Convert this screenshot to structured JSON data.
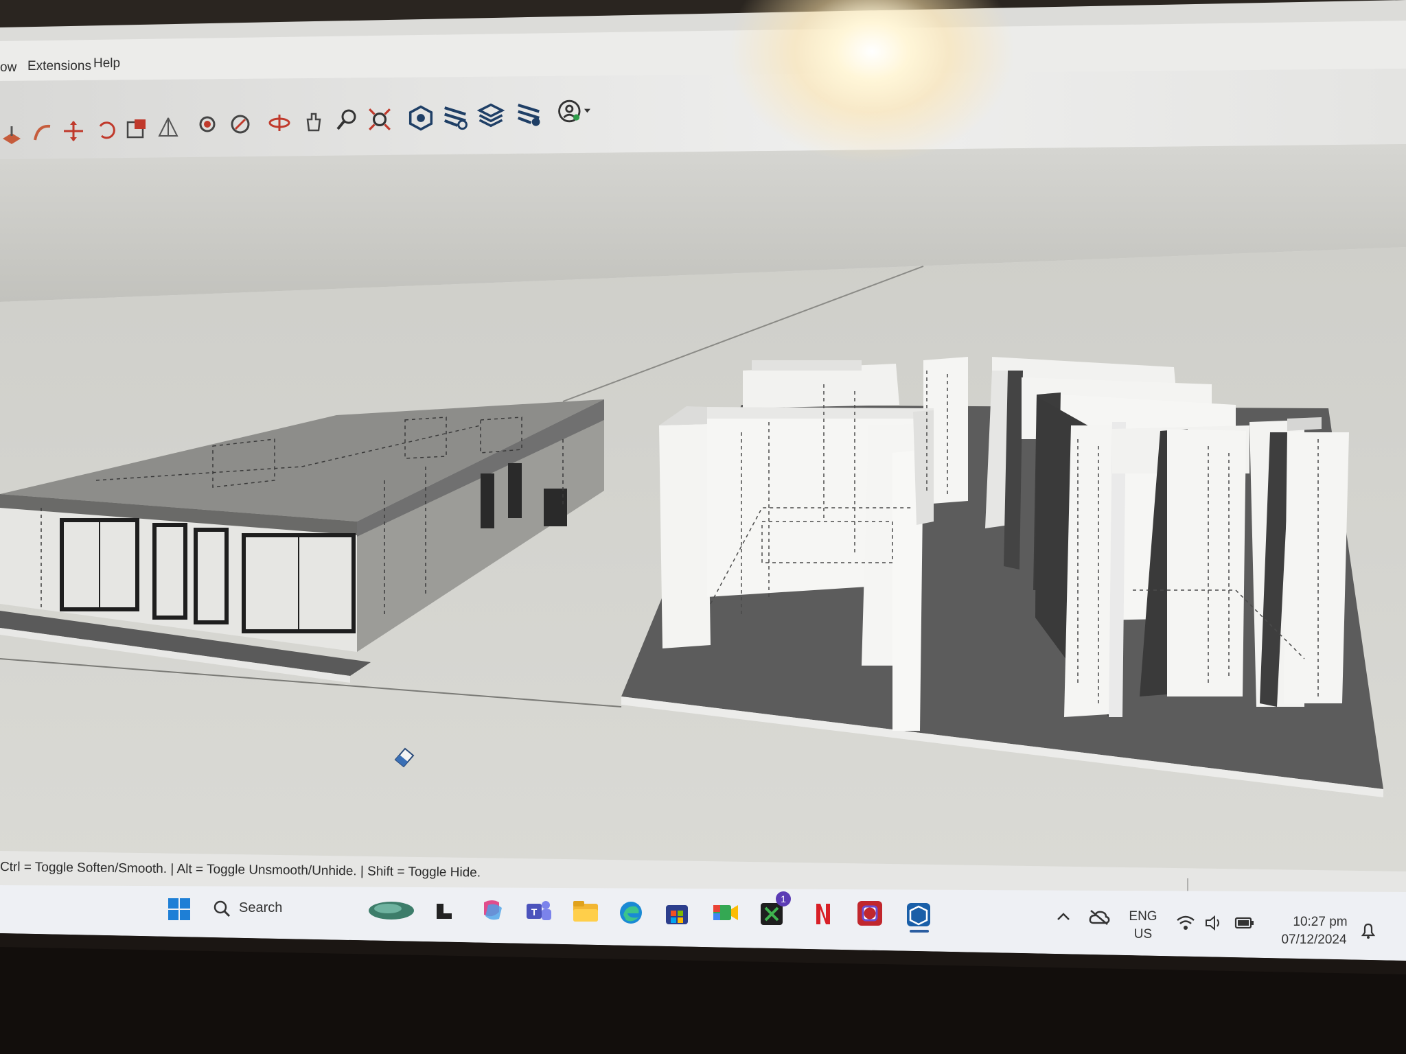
{
  "menubar": {
    "items": [
      {
        "label": "ow"
      },
      {
        "label": "Extensions"
      },
      {
        "label": "Help"
      }
    ]
  },
  "toolbar": {
    "tools": [
      "push-pull-icon",
      "follow-me-icon",
      "move-icon",
      "rotate-icon",
      "scale-icon",
      "flip-icon",
      "paint-bucket-icon",
      "materials-icon",
      "orbit-icon",
      "pan-icon",
      "zoom-icon",
      "zoom-extents-icon",
      "warehouse-icon",
      "components-icon",
      "layers-icon",
      "extension-manager-icon",
      "account-icon"
    ]
  },
  "viewport": {
    "background_sky": "#c9c9c4",
    "background_ground": "#d3d3ce",
    "cursor": "eraser-cursor-icon"
  },
  "statusbar": {
    "hint": "Ctrl = Toggle Soften/Smooth. | Alt = Toggle Unsmooth/Unhide. | Shift = Toggle Hide."
  },
  "taskbar": {
    "search_placeholder": "Search",
    "apps": [
      "start-icon",
      "widgets-icon",
      "task-view-icon",
      "copilot-icon",
      "teams-icon",
      "file-explorer-icon",
      "edge-icon",
      "store-icon",
      "meet-icon",
      "xbox-icon",
      "netflix-icon",
      "app-icon",
      "sketchup-icon"
    ],
    "xbox_badge": "1",
    "tray": {
      "language_line1": "ENG",
      "language_line2": "US",
      "time": "10:27 pm",
      "date": "07/12/2024"
    }
  }
}
